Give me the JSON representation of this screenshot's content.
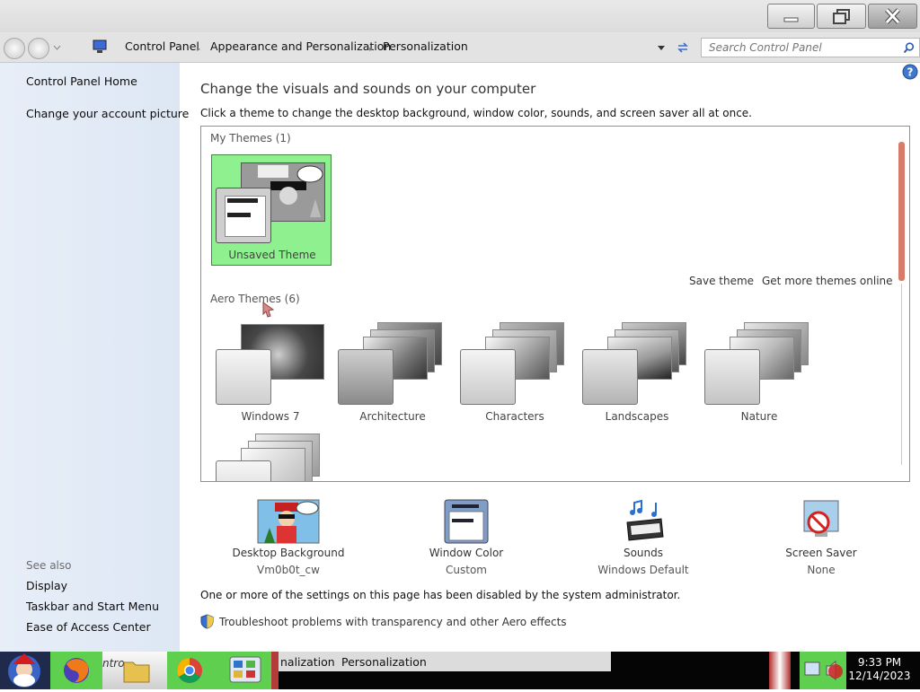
{
  "window": {
    "caption_buttons": {
      "minimize": "minimize-icon",
      "maximize": "restore-icon",
      "close": "close-icon"
    }
  },
  "address_bar": {
    "breadcrumbs": [
      "Control Panel",
      "Appearance and Personalization",
      "Personalization"
    ],
    "search_placeholder": "Search Control Panel"
  },
  "left_pane": {
    "links": [
      "Control Panel Home",
      "Change your account picture"
    ],
    "see_also_title": "See also",
    "see_also": [
      "Display",
      "Taskbar and Start Menu",
      "Ease of Access Center"
    ]
  },
  "main": {
    "heading": "Change the visuals and sounds on your computer",
    "instruction": "Click a theme to change the desktop background, window color, sounds, and screen saver all at once.",
    "my_themes_header": "My Themes (1)",
    "my_themes": [
      {
        "name": "Unsaved Theme",
        "selected": true
      }
    ],
    "save_theme": "Save theme",
    "get_more_themes": "Get more themes online",
    "aero_themes_header": "Aero Themes (6)",
    "aero_themes": [
      "Windows 7",
      "Architecture",
      "Characters",
      "Landscapes",
      "Nature"
    ],
    "selected_color": "#8ff08f"
  },
  "settings": [
    {
      "label": "Desktop Background",
      "value": "Vm0b0t_cw"
    },
    {
      "label": "Window Color",
      "value": "Custom"
    },
    {
      "label": "Sounds",
      "value": "Windows Default"
    },
    {
      "label": "Screen Saver",
      "value": "None"
    }
  ],
  "disabled_message": "One or more of the settings on this page has been disabled by the system administrator.",
  "troubleshoot_link": "Troubleshoot problems with transparency and other Aero effects",
  "taskbar": {
    "buttons": [
      "nalization",
      "Personalization"
    ],
    "partial_label": "ntro",
    "time": "9:33 PM",
    "date": "12/14/2023"
  }
}
